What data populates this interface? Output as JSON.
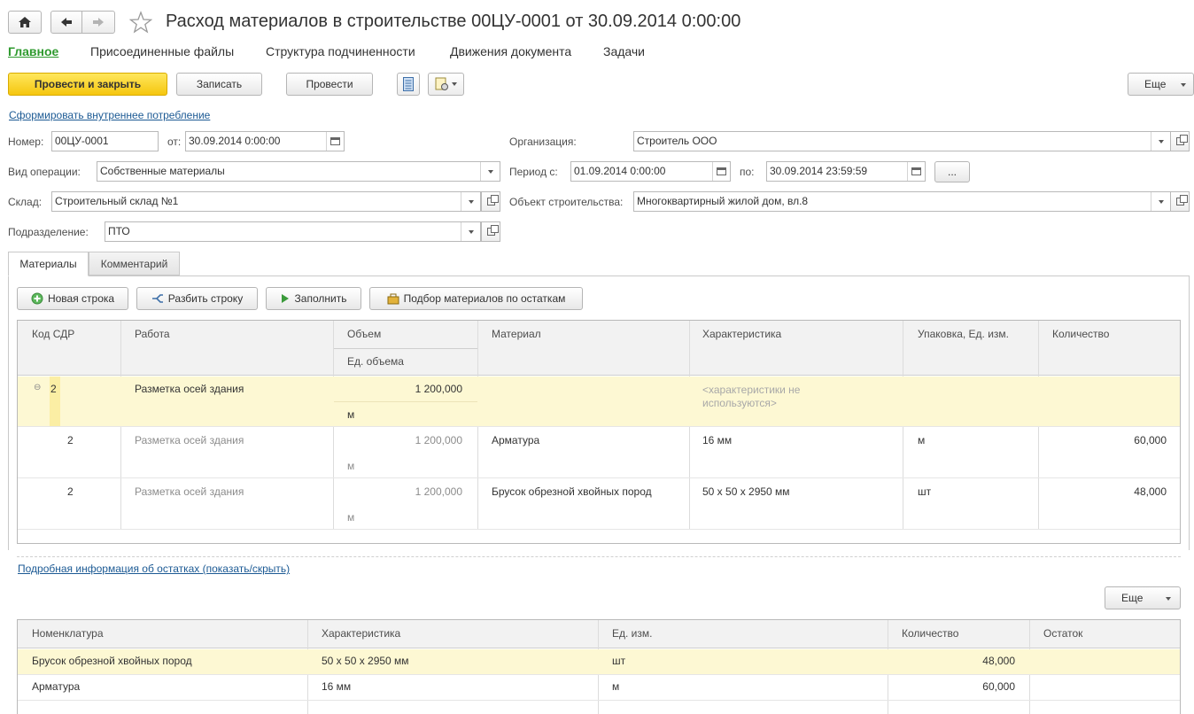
{
  "window": {
    "title": "Расход материалов в строительстве 00ЦУ-0001 от 30.09.2014 0:00:00"
  },
  "nav_tabs": [
    "Главное",
    "Присоединенные файлы",
    "Структура подчиненности",
    "Движения документа",
    "Задачи"
  ],
  "toolbar": {
    "post_close": "Провести и закрыть",
    "save": "Записать",
    "post": "Провести",
    "more": "Еще"
  },
  "links": {
    "internal_consumption": "Сформировать внутреннее потребление",
    "stock_details": "Подробная информация об остатках (показать/скрыть)"
  },
  "form": {
    "number_label": "Номер:",
    "number": "00ЦУ-0001",
    "date_label": "от:",
    "date": "30.09.2014  0:00:00",
    "org_label": "Организация:",
    "org": "Строитель ООО",
    "op_label": "Вид операции:",
    "op": "Собственные материалы",
    "period_label": "Период с:",
    "period_from": "01.09.2014  0:00:00",
    "period_to_label": "по:",
    "period_to": "30.09.2014 23:59:59",
    "period_btn": "...",
    "warehouse_label": "Склад:",
    "warehouse": "Строительный склад №1",
    "object_label": "Объект строительства:",
    "object": "Многоквартирный жилой дом, вл.8",
    "division_label": "Подразделение:",
    "division": "ПТО"
  },
  "tabs": [
    "Материалы",
    "Комментарий"
  ],
  "table_toolbar": {
    "new_row": "Новая строка",
    "split_row": "Разбить строку",
    "fill": "Заполнить",
    "pick": "Подбор материалов по остаткам"
  },
  "materials_table": {
    "headers": {
      "code": "Код СДР",
      "work": "Работа",
      "volume": "Объем",
      "volume_unit": "Ед. объема",
      "material": "Материал",
      "characteristic": "Характеристика",
      "pack": "Упаковка, Ед. изм.",
      "qty": "Количество"
    },
    "rows": [
      {
        "code": "2",
        "work": "Разметка осей здания",
        "volume": "1 200,000",
        "unit": "м",
        "material": "",
        "char1": "<характеристики не",
        "char2": "используются>",
        "pack": "",
        "qty": ""
      },
      {
        "code": "2",
        "work": "Разметка осей здания",
        "volume": "1 200,000",
        "unit": "м",
        "material": "Арматура",
        "char1": "16 мм",
        "char2": "",
        "pack": "м",
        "qty": "60,000"
      },
      {
        "code": "2",
        "work": "Разметка осей здания",
        "volume": "1 200,000",
        "unit": "м",
        "material": "Брусок обрезной хвойных пород",
        "char1": "50 х 50 х 2950 мм",
        "char2": "",
        "pack": "шт",
        "qty": "48,000"
      }
    ]
  },
  "stock_more": "Еще",
  "stock_table": {
    "headers": [
      "Номенклатура",
      "Характеристика",
      "Ед. изм.",
      "Количество",
      "Остаток"
    ],
    "rows": [
      [
        "Брусок обрезной хвойных пород",
        "50 х 50 х 2950 мм",
        "шт",
        "48,000",
        ""
      ],
      [
        "Арматура",
        "16 мм",
        "м",
        "60,000",
        ""
      ]
    ]
  },
  "colors": {
    "accent_green": "#2e9a2e",
    "highlight_row": "#fdf8d3",
    "link": "#1c5a94",
    "yellow_button": "#f5c60f"
  }
}
